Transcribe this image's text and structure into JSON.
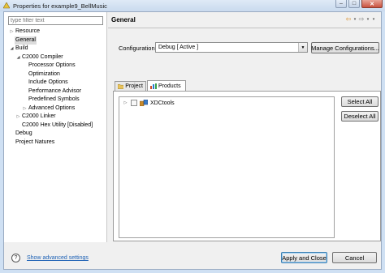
{
  "window": {
    "title": "Properties for example9_BellMusic",
    "controls": {
      "minimize": "–",
      "maximize": "□",
      "close": "✕"
    }
  },
  "filter": {
    "placeholder": "type filter text"
  },
  "tree": [
    {
      "label": "Resource",
      "depth": 0,
      "expander": "▷"
    },
    {
      "label": "General",
      "depth": 0,
      "expander": "",
      "selected": true
    },
    {
      "label": "Build",
      "depth": 0,
      "expander": "◢"
    },
    {
      "label": "C2000 Compiler",
      "depth": 1,
      "expander": "◢"
    },
    {
      "label": "Processor Options",
      "depth": 2,
      "expander": ""
    },
    {
      "label": "Optimization",
      "depth": 2,
      "expander": ""
    },
    {
      "label": "Include Options",
      "depth": 2,
      "expander": ""
    },
    {
      "label": "Performance Advisor",
      "depth": 2,
      "expander": ""
    },
    {
      "label": "Predefined Symbols",
      "depth": 2,
      "expander": ""
    },
    {
      "label": "Advanced Options",
      "depth": 2,
      "expander": "▷"
    },
    {
      "label": "C2000 Linker",
      "depth": 1,
      "expander": "▷"
    },
    {
      "label": "C2000 Hex Utility  [Disabled]",
      "depth": 1,
      "expander": ""
    },
    {
      "label": "Debug",
      "depth": 0,
      "expander": ""
    },
    {
      "label": "Project Natures",
      "depth": 0,
      "expander": ""
    }
  ],
  "page": {
    "title": "General"
  },
  "nav": {
    "back_icon": "⇦",
    "forward_icon": "⇨",
    "dropdown": "▾",
    "menu": "▾"
  },
  "configuration": {
    "label": "Configuration:",
    "value": "Debug  [ Active ]",
    "manage_label": "Manage Configurations..."
  },
  "tabs": [
    {
      "label": "Project",
      "active": false
    },
    {
      "label": "Products",
      "active": true
    }
  ],
  "products": [
    {
      "label": "XDCtools",
      "checked": false,
      "expander": "▷"
    }
  ],
  "buttons": {
    "select_all": "Select All",
    "deselect_all": "Deselect All",
    "apply_close": "Apply and Close",
    "cancel": "Cancel"
  },
  "footer": {
    "help_icon": "?",
    "advanced_link": "Show advanced settings"
  },
  "colors": {
    "accent": "#3c7fb1",
    "link": "#1a5fb4",
    "frame": "#cfe0f3"
  }
}
